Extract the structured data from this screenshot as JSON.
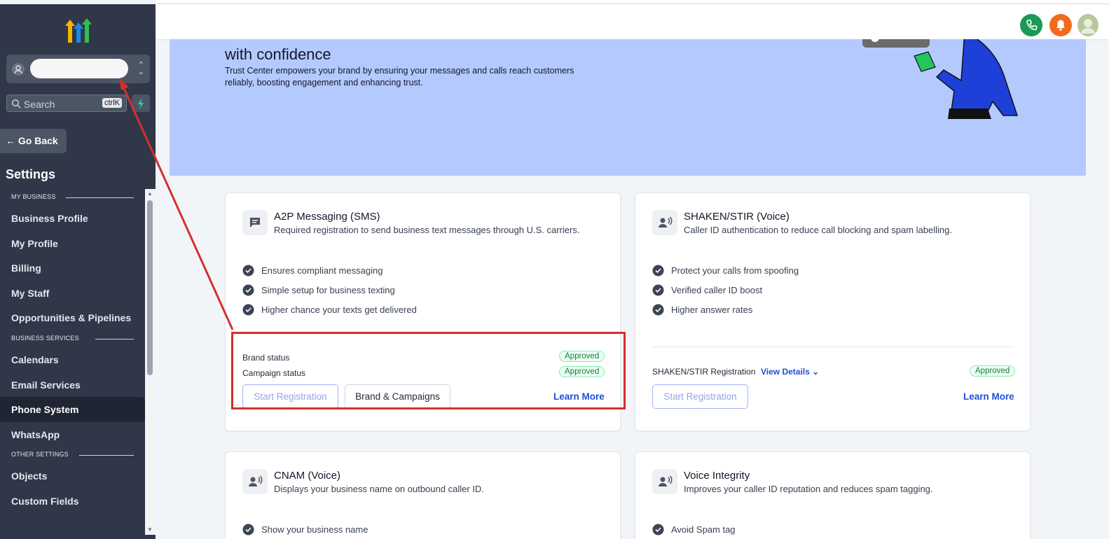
{
  "sidebar": {
    "search_placeholder": "Search",
    "search_shortcut": "ctrlK",
    "go_back": "Go Back",
    "title": "Settings",
    "sections": [
      {
        "label": "MY BUSINESS",
        "items": [
          "Business Profile",
          "My Profile",
          "Billing",
          "My Staff",
          "Opportunities & Pipelines"
        ]
      },
      {
        "label": "BUSINESS SERVICES",
        "items": [
          "Calendars",
          "Email Services",
          "Phone System",
          "WhatsApp"
        ]
      },
      {
        "label": "OTHER SETTINGS",
        "items": [
          "Objects",
          "Custom Fields"
        ]
      }
    ],
    "active_item": "Phone System"
  },
  "topbar": {
    "icons": [
      "phone-icon",
      "bell-icon",
      "avatar"
    ],
    "colors": {
      "phone": "#1a9a54",
      "bell": "#f26b1d",
      "avatar": "#b9c79a"
    }
  },
  "hero": {
    "title": "with confidence",
    "description": "Trust Center empowers your brand by ensuring your messages and calls reach customers reliably, boosting engagement and enhancing trust."
  },
  "cards": {
    "a2p": {
      "title": "A2P Messaging (SMS)",
      "subtitle": "Required registration to send business text messages through U.S. carriers.",
      "features": [
        "Ensures compliant messaging",
        "Simple setup for business texting",
        "Higher chance your texts get delivered"
      ],
      "brand_status_label": "Brand status",
      "brand_status": "Approved",
      "campaign_status_label": "Campaign status",
      "campaign_status": "Approved",
      "start_button": "Start Registration",
      "brand_button": "Brand & Campaigns",
      "learn_more": "Learn More"
    },
    "shaken": {
      "title": "SHAKEN/STIR (Voice)",
      "subtitle": "Caller ID authentication to reduce call blocking and spam labelling.",
      "features": [
        "Protect your calls from spoofing",
        "Verified caller ID boost",
        "Higher answer rates"
      ],
      "registration_label": "SHAKEN/STIR Registration",
      "view_details": "View Details",
      "status": "Approved",
      "start_button": "Start Registration",
      "learn_more": "Learn More"
    },
    "cnam": {
      "title": "CNAM (Voice)",
      "subtitle": "Displays your business name on outbound caller ID.",
      "features": [
        "Show your business name"
      ]
    },
    "voice_integrity": {
      "title": "Voice Integrity",
      "subtitle": "Improves your caller ID reputation and reduces spam tagging.",
      "features": [
        "Avoid Spam tag"
      ]
    }
  },
  "annotation_color": "#d32f2f"
}
